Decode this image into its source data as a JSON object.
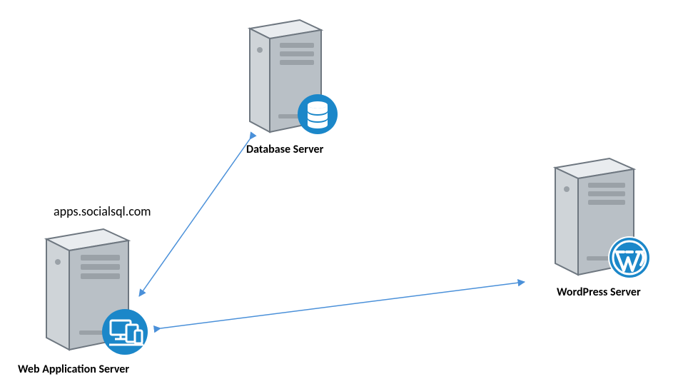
{
  "diagram": {
    "nodes": {
      "db": {
        "label": "Database Server",
        "badge": "database"
      },
      "web": {
        "label": "Web Application Server",
        "annotation": "apps.socialsql.com",
        "badge": "devices"
      },
      "wp": {
        "label": "WordPress Server",
        "badge": "wordpress"
      }
    },
    "edges": [
      {
        "from": "db",
        "to": "web",
        "bidirectional": true
      },
      {
        "from": "web",
        "to": "wp",
        "bidirectional": true
      }
    ],
    "colors": {
      "accent": "#1b87c9",
      "arrow": "#4a90d9",
      "server_body": "#cfd4d8",
      "server_shadow": "#9aa1a7",
      "server_highlight": "#e9ecef"
    }
  }
}
